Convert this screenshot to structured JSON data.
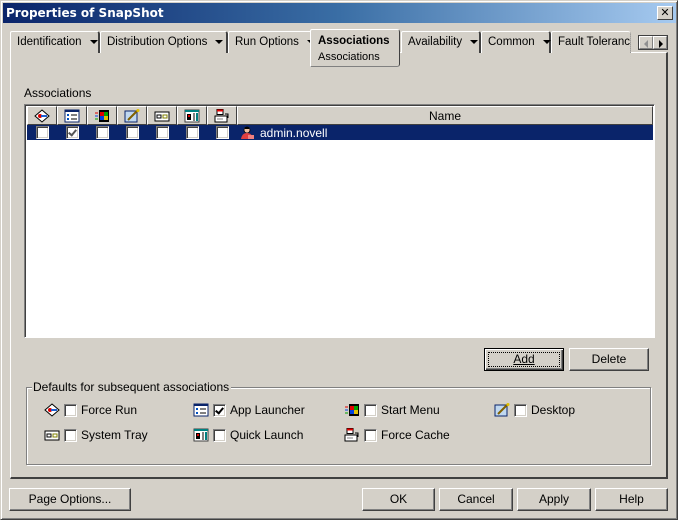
{
  "window": {
    "title": "Properties of SnapShot"
  },
  "tabs": [
    {
      "label": "Identification",
      "has_dropdown": true
    },
    {
      "label": "Distribution Options",
      "has_dropdown": true
    },
    {
      "label": "Run Options",
      "has_dropdown": true
    },
    {
      "label": "Associations",
      "sublabel": "Associations",
      "active": true
    },
    {
      "label": "Availability",
      "has_dropdown": true
    },
    {
      "label": "Common",
      "has_dropdown": true
    },
    {
      "label": "Fault Toleranc",
      "has_dropdown": false
    }
  ],
  "associations": {
    "section_label": "Associations",
    "columns": [
      {
        "icon": "force-run-icon"
      },
      {
        "icon": "app-launcher-icon"
      },
      {
        "icon": "start-menu-icon"
      },
      {
        "icon": "desktop-icon"
      },
      {
        "icon": "system-tray-icon"
      },
      {
        "icon": "quick-launch-icon"
      },
      {
        "icon": "force-cache-icon"
      },
      {
        "label": "Name"
      }
    ],
    "rows": [
      {
        "name": "admin.novell",
        "selected": true,
        "force_run": false,
        "app_launcher": true,
        "start_menu": false,
        "desktop": false,
        "system_tray": false,
        "quick_launch": false,
        "force_cache": false
      }
    ],
    "add_label": "Add",
    "delete_label": "Delete"
  },
  "defaults": {
    "label": "Defaults for subsequent associations",
    "options": [
      {
        "key": "force_run",
        "label": "Force Run",
        "checked": false
      },
      {
        "key": "app_launcher",
        "label": "App Launcher",
        "checked": true
      },
      {
        "key": "start_menu",
        "label": "Start Menu",
        "checked": false
      },
      {
        "key": "desktop",
        "label": "Desktop",
        "checked": false
      },
      {
        "key": "system_tray",
        "label": "System Tray",
        "checked": false
      },
      {
        "key": "quick_launch",
        "label": "Quick Launch",
        "checked": false
      },
      {
        "key": "force_cache",
        "label": "Force Cache",
        "checked": false
      }
    ]
  },
  "footer": {
    "page_options": "Page Options...",
    "ok": "OK",
    "cancel": "Cancel",
    "apply": "Apply",
    "help": "Help"
  },
  "colors": {
    "selection": "#0a246a",
    "face": "#d4d0c8",
    "title_start": "#0a246a",
    "title_end": "#a6caf0"
  }
}
